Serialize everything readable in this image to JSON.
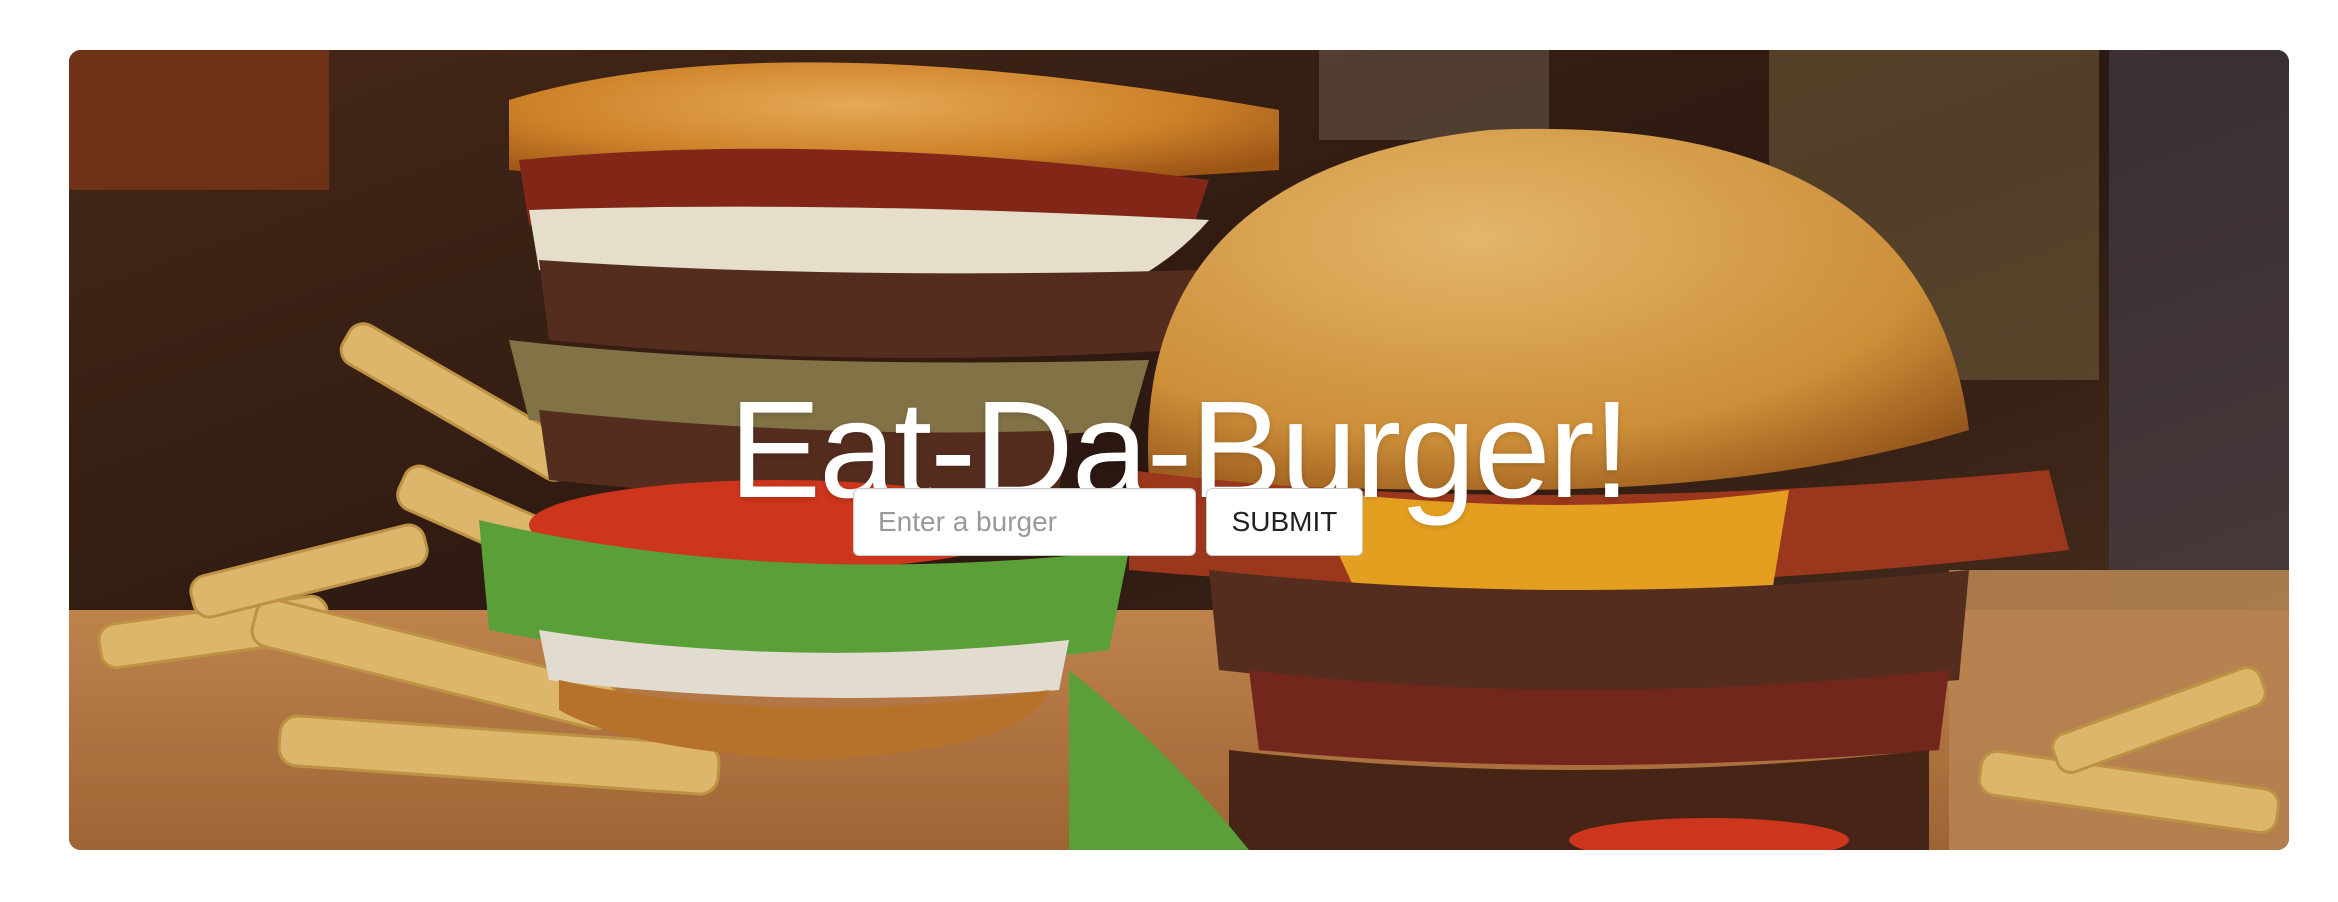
{
  "hero": {
    "title": "Eat-Da-Burger!",
    "background_image": "burgers-and-fries-photo"
  },
  "form": {
    "input_placeholder": "Enter a burger",
    "input_value": "",
    "submit_label": "SUBMIT"
  },
  "colors": {
    "page_background": "#ffffff",
    "title_text": "#ffffff",
    "button_text": "#222222",
    "placeholder_text": "#999999"
  }
}
